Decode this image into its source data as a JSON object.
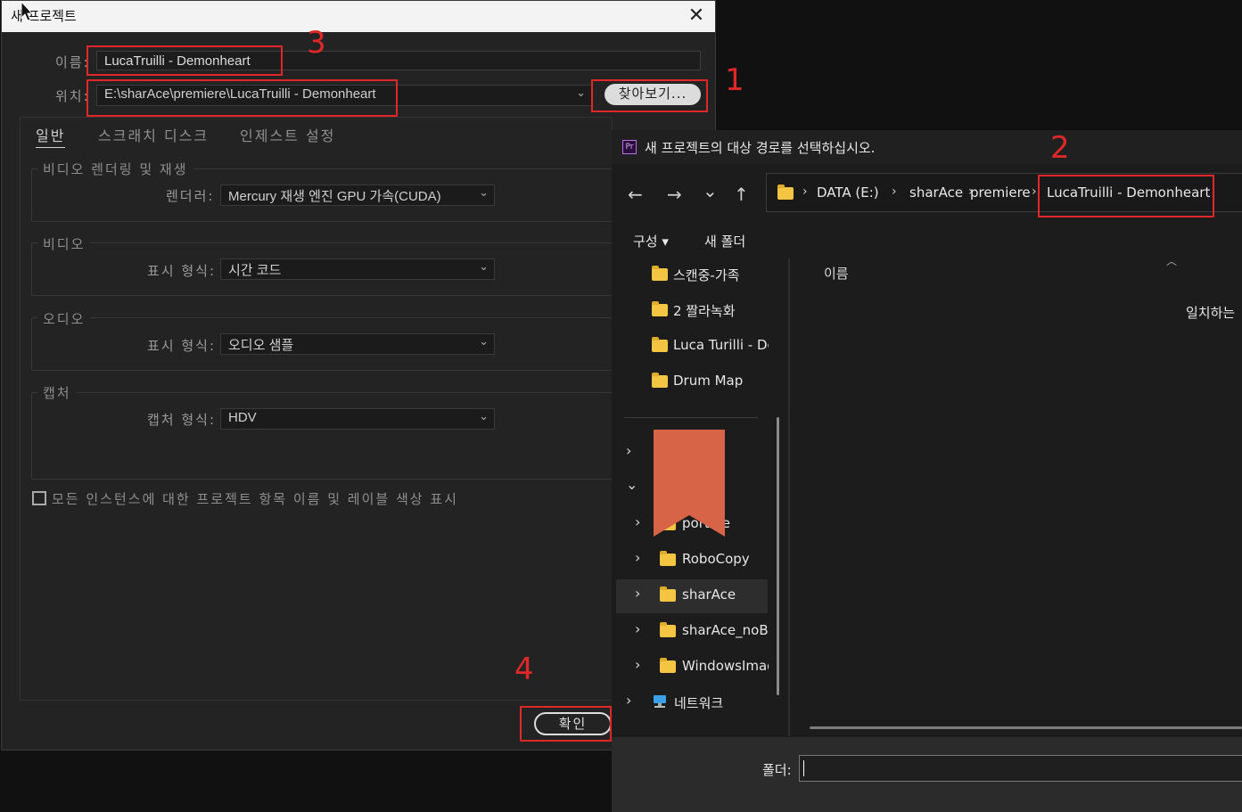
{
  "pr_dialog": {
    "title": "새 프로젝트",
    "close_glyph": "✕",
    "name_label": "이름:",
    "name_value": "LucaTruilli - Demonheart",
    "location_label": "위치:",
    "location_value": "E:\\sharAce\\premiere\\LucaTruilli - Demonheart",
    "browse_label": "찾아보기...",
    "tabs": [
      "일반",
      "스크래치 디스크",
      "인제스트 설정"
    ],
    "groups": {
      "render": {
        "title": "비디오 렌더링 및 재생",
        "label": "렌더러:",
        "value": "Mercury 재생 엔진 GPU 가속(CUDA)"
      },
      "video": {
        "title": "비디오",
        "label": "표시 형식:",
        "value": "시간 코드"
      },
      "audio": {
        "title": "오디오",
        "label": "표시 형식:",
        "value": "오디오 샘플"
      },
      "capture": {
        "title": "캡처",
        "label": "캡처 형식:",
        "value": "HDV"
      }
    },
    "checkbox_label": "모든 인스턴스에 대한 프로젝트 항목 이름 및 레이블 색상 표시",
    "ok_label": "확인"
  },
  "annotations": {
    "n1": "1",
    "n2": "2",
    "n3": "3",
    "n4": "4",
    "color": "#e02828"
  },
  "picker": {
    "app_icon": "Pr",
    "title": "새 프로젝트의 대상 경로를 선택하십시오.",
    "nav": {
      "back": "←",
      "forward": "→",
      "recent": "⌄",
      "up": "↑"
    },
    "breadcrumb": [
      "DATA (E:)",
      "sharAce",
      "premiere",
      "LucaTruilli - Demonheart"
    ],
    "organize": "구성 ▾",
    "new_folder": "새 폴더",
    "quick_access": [
      "스캔중-가족",
      "2 짤라녹화",
      "Luca Turilli - De",
      "Drum Map"
    ],
    "tree": {
      "drive_partial": ":)",
      "children": [
        "porta  e",
        "RoboCopy",
        "sharAce",
        "sharAce_noBa",
        "WindowsImag"
      ],
      "network": "네트워크"
    },
    "column_name": "이름",
    "empty_message": "일치하는",
    "folder_label": "폴더:"
  },
  "colors": {
    "folder": "#f4c542",
    "bookmark": "#d76447",
    "accent_red": "#e02828"
  }
}
